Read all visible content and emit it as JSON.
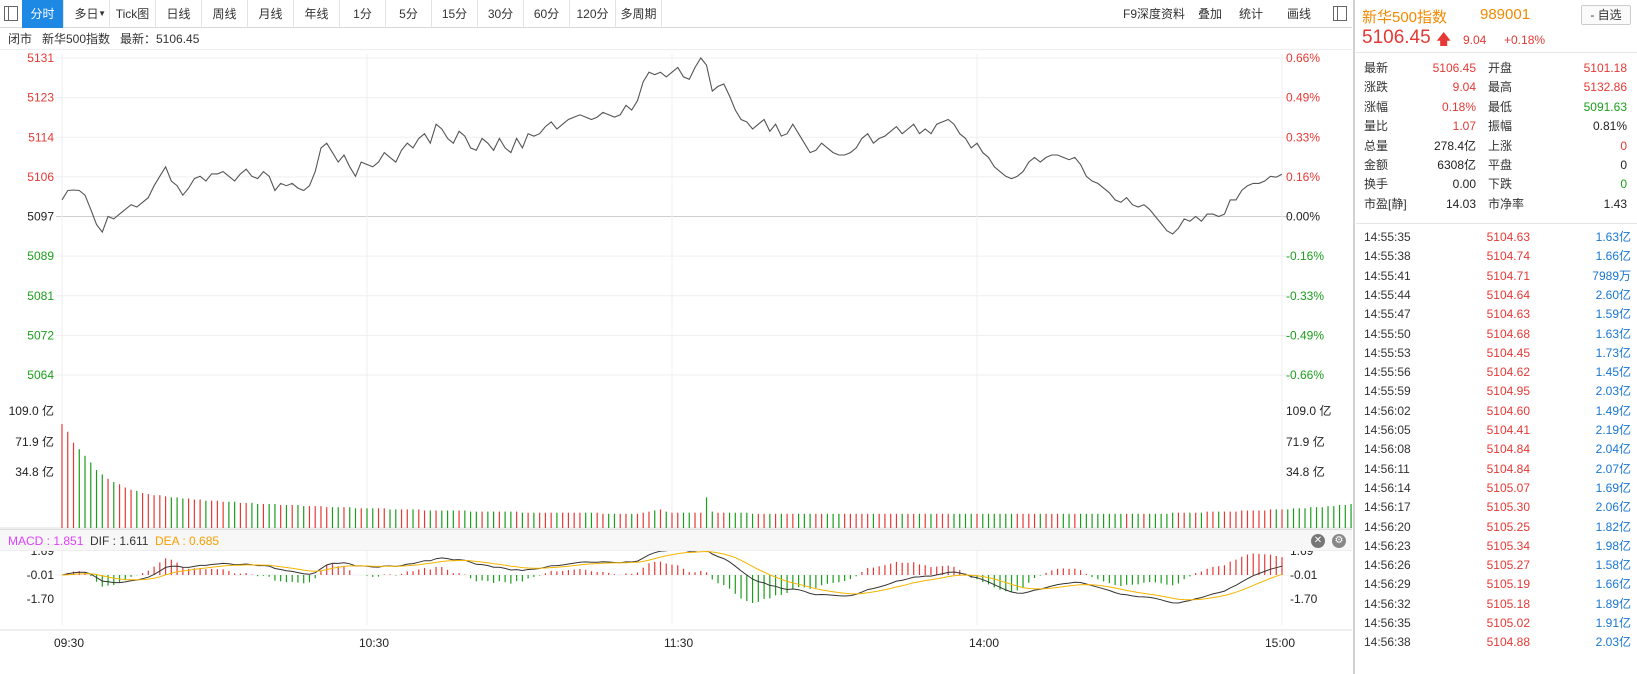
{
  "toolbar": {
    "tabs": [
      "分时",
      "多日",
      "Tick图",
      "日线",
      "周线",
      "月线",
      "年线",
      "1分",
      "5分",
      "15分",
      "30分",
      "60分",
      "120分",
      "多周期"
    ],
    "right_buttons": [
      "F9深度资料",
      "叠加",
      "统计",
      "画线"
    ]
  },
  "infobar": {
    "status": "闭市",
    "index_name": "新华500指数",
    "latest_label": "最新：5106.45"
  },
  "price_axis": {
    "left": [
      "5131",
      "5123",
      "5114",
      "5106",
      "5097",
      "5089",
      "5081",
      "5072",
      "5064"
    ],
    "right": [
      "0.66%",
      "0.49%",
      "0.33%",
      "0.16%",
      "0.00%",
      "-0.16%",
      "-0.33%",
      "-0.49%",
      "-0.66%"
    ]
  },
  "volume_axis": [
    "109.0 亿",
    "71.9 亿",
    "34.8 亿"
  ],
  "macd_header": {
    "macd": "MACD : 1.851",
    "dif": "DIF : 1.611",
    "dea": "DEA : 0.685"
  },
  "macd_axis": [
    "1.69",
    "-0.01",
    "-1.70"
  ],
  "time_axis": [
    "09:30",
    "10:30",
    "11:30",
    "14:00",
    "15:00"
  ],
  "chart_data": {
    "type": "line",
    "prev_close": 5097.41,
    "price_range": [
      5064,
      5131
    ],
    "price": [
      5101.0,
      5103.0,
      5103.1,
      5103.0,
      5102.0,
      5099.0,
      5095.8,
      5094.2,
      5097.5,
      5097.0,
      5098.0,
      5099.0,
      5100.0,
      5099.5,
      5100.5,
      5101.5,
      5104.0,
      5106.0,
      5108.0,
      5105.0,
      5104.0,
      5102.0,
      5103.5,
      5105.5,
      5106.0,
      5105.0,
      5106.5,
      5106.5,
      5107.0,
      5106.0,
      5105.0,
      5106.5,
      5107.5,
      5106.0,
      5105.5,
      5107.0,
      5106.0,
      5103.0,
      5104.5,
      5104.0,
      5104.5,
      5103.5,
      5103.0,
      5104.0,
      5107.0,
      5112.0,
      5113.0,
      5111.0,
      5109.0,
      5110.5,
      5108.0,
      5106.0,
      5109.0,
      5108.5,
      5108.0,
      5109.0,
      5111.0,
      5110.0,
      5109.0,
      5111.5,
      5113.0,
      5112.0,
      5114.0,
      5115.0,
      5113.0,
      5117.0,
      5116.0,
      5114.0,
      5113.0,
      5115.5,
      5114.5,
      5112.0,
      5111.5,
      5114.0,
      5113.0,
      5111.5,
      5114.0,
      5112.0,
      5111.0,
      5114.0,
      5112.0,
      5115.0,
      5114.5,
      5115.0,
      5116.5,
      5117.5,
      5116.0,
      5117.0,
      5118.0,
      5118.5,
      5119.0,
      5118.5,
      5118.0,
      5118.5,
      5119.5,
      5119.0,
      5118.5,
      5119.0,
      5121.0,
      5120.0,
      5122.0,
      5126.0,
      5128.0,
      5127.5,
      5128.0,
      5127.0,
      5128.0,
      5129.0,
      5127.0,
      5126.5,
      5129.0,
      5131.0,
      5129.5,
      5124.0,
      5125.0,
      5125.5,
      5123.0,
      5120.0,
      5118.0,
      5117.5,
      5116.0,
      5117.0,
      5118.0,
      5115.5,
      5117.0,
      5114.5,
      5115.0,
      5117.0,
      5115.0,
      5113.0,
      5111.0,
      5111.5,
      5113.0,
      5112.0,
      5111.0,
      5110.5,
      5110.5,
      5111.0,
      5112.0,
      5114.0,
      5115.0,
      5113.0,
      5114.0,
      5114.5,
      5115.5,
      5116.5,
      5115.0,
      5116.0,
      5117.0,
      5115.0,
      5116.0,
      5115.0,
      5117.0,
      5117.5,
      5118.0,
      5117.0,
      5115.0,
      5114.0,
      5112.0,
      5113.0,
      5111.0,
      5110.0,
      5108.0,
      5107.0,
      5106.0,
      5105.5,
      5106.0,
      5107.0,
      5109.0,
      5110.0,
      5109.0,
      5110.0,
      5110.5,
      5110.5,
      5110.0,
      5109.5,
      5110.0,
      5108.5,
      5106.0,
      5105.0,
      5104.5,
      5103.5,
      5102.5,
      5101.0,
      5100.5,
      5101.5,
      5100.0,
      5099.5,
      5100.0,
      5099.0,
      5097.5,
      5096.0,
      5094.5,
      5093.8,
      5095.0,
      5097.0,
      5096.5,
      5097.5,
      5096.5,
      5098.0,
      5098.0,
      5097.5,
      5098.0,
      5101.0,
      5101.0,
      5103.0,
      5104.0,
      5104.5,
      5104.5,
      5105.0,
      5106.0,
      5105.8,
      5106.45
    ],
    "volume_yi": [
      95,
      88,
      78,
      72,
      66,
      60,
      53,
      49,
      45,
      42,
      40,
      37,
      35,
      34,
      32,
      31,
      30,
      30,
      29,
      28,
      28,
      27,
      27,
      26,
      26,
      25,
      25,
      25,
      24,
      24,
      24,
      23,
      23,
      23,
      22,
      22,
      22,
      22,
      21,
      21,
      21,
      21,
      20,
      20,
      20,
      20,
      19,
      19,
      19,
      19,
      19,
      18,
      18,
      18,
      18,
      18,
      18,
      17,
      17,
      17,
      17,
      17,
      17,
      16,
      16,
      16,
      16,
      16,
      16,
      16,
      16,
      15,
      15,
      15,
      15,
      15,
      15,
      15,
      15,
      15,
      14,
      14,
      14,
      14,
      14,
      14,
      14,
      14,
      14,
      14,
      14,
      14,
      14,
      14,
      13,
      13,
      13,
      13,
      13,
      13,
      13,
      14,
      15,
      16,
      17,
      15,
      14,
      14,
      14,
      14,
      14,
      14,
      28,
      15,
      14,
      14,
      14,
      14,
      14,
      14,
      13,
      13,
      13,
      13,
      13,
      13,
      13,
      13,
      13,
      13,
      13,
      13,
      13,
      13,
      13,
      13,
      13,
      13,
      13,
      13,
      13,
      13,
      13,
      13,
      13,
      13,
      13,
      13,
      13,
      13,
      13,
      13,
      13,
      13,
      13,
      13,
      13,
      13,
      13,
      13,
      13,
      13,
      13,
      13,
      13,
      13,
      13,
      13,
      13,
      13,
      13,
      13,
      13,
      13,
      13,
      13,
      13,
      13,
      13,
      13,
      13,
      13,
      13,
      13,
      13,
      13,
      13,
      13,
      13,
      13,
      13,
      13,
      13,
      14,
      14,
      14,
      14,
      14,
      14,
      15,
      15,
      15,
      15,
      15,
      15,
      16,
      16,
      16,
      16,
      16,
      17,
      17,
      17,
      17,
      18,
      18,
      18,
      19,
      19,
      19,
      20,
      20,
      21,
      21,
      22,
      23,
      24,
      26,
      30,
      50
    ],
    "volume_range": [
      0,
      128
    ]
  },
  "panel": {
    "title": "新华500指数",
    "code": "989001",
    "watch_button": "- 自选",
    "price": "5106.45",
    "change": "9.04",
    "change_pct": "+0.18%",
    "quote_rows": [
      {
        "l1": "最新",
        "v1": "5106.45",
        "c1": "#e53935",
        "l2": "开盘",
        "v2": "5101.18",
        "c2": "#e53935"
      },
      {
        "l1": "涨跌",
        "v1": "9.04",
        "c1": "#e53935",
        "l2": "最高",
        "v2": "5132.86",
        "c2": "#e53935"
      },
      {
        "l1": "涨幅",
        "v1": "0.18%",
        "c1": "#e53935",
        "l2": "最低",
        "v2": "5091.63",
        "c2": "#1b9e1b"
      },
      {
        "l1": "量比",
        "v1": "1.07",
        "c1": "#e53935",
        "l2": "振幅",
        "v2": "0.81%",
        "c2": "#222222"
      },
      {
        "l1": "总量",
        "v1": "278.4亿",
        "c1": "#222222",
        "l2": "上涨",
        "v2": "0",
        "c2": "#e53935"
      },
      {
        "l1": "金额",
        "v1": "6308亿",
        "c1": "#222222",
        "l2": "平盘",
        "v2": "0",
        "c2": "#222222"
      },
      {
        "l1": "换手",
        "v1": "0.00",
        "c1": "#222222",
        "l2": "下跌",
        "v2": "0",
        "c2": "#1b9e1b"
      },
      {
        "l1": "市盈[静]",
        "v1": "14.03",
        "c1": "#222222",
        "l2": "市净率",
        "v2": "1.43",
        "c2": "#222222"
      }
    ],
    "ticks": [
      {
        "time": "14:55:35",
        "price": "5104.63",
        "amount": "1.63亿"
      },
      {
        "time": "14:55:38",
        "price": "5104.74",
        "amount": "1.66亿"
      },
      {
        "time": "14:55:41",
        "price": "5104.71",
        "amount": "7989万"
      },
      {
        "time": "14:55:44",
        "price": "5104.64",
        "amount": "2.60亿"
      },
      {
        "time": "14:55:47",
        "price": "5104.63",
        "amount": "1.59亿"
      },
      {
        "time": "14:55:50",
        "price": "5104.68",
        "amount": "1.63亿"
      },
      {
        "time": "14:55:53",
        "price": "5104.45",
        "amount": "1.73亿"
      },
      {
        "time": "14:55:56",
        "price": "5104.62",
        "amount": "1.45亿"
      },
      {
        "time": "14:55:59",
        "price": "5104.95",
        "amount": "2.03亿"
      },
      {
        "time": "14:56:02",
        "price": "5104.60",
        "amount": "1.49亿"
      },
      {
        "time": "14:56:05",
        "price": "5104.41",
        "amount": "2.19亿"
      },
      {
        "time": "14:56:08",
        "price": "5104.84",
        "amount": "2.04亿"
      },
      {
        "time": "14:56:11",
        "price": "5104.84",
        "amount": "2.07亿"
      },
      {
        "time": "14:56:14",
        "price": "5105.07",
        "amount": "1.69亿"
      },
      {
        "time": "14:56:17",
        "price": "5105.30",
        "amount": "2.06亿"
      },
      {
        "time": "14:56:20",
        "price": "5105.25",
        "amount": "1.82亿"
      },
      {
        "time": "14:56:23",
        "price": "5105.34",
        "amount": "1.98亿"
      },
      {
        "time": "14:56:26",
        "price": "5105.27",
        "amount": "1.58亿"
      },
      {
        "time": "14:56:29",
        "price": "5105.19",
        "amount": "1.66亿"
      },
      {
        "time": "14:56:32",
        "price": "5105.18",
        "amount": "1.89亿"
      },
      {
        "time": "14:56:35",
        "price": "5105.02",
        "amount": "1.91亿"
      },
      {
        "time": "14:56:38",
        "price": "5104.88",
        "amount": "2.03亿"
      }
    ]
  },
  "colors": {
    "up": "#e53935",
    "down": "#1b9e1b",
    "accent": "#1e88e5",
    "brand": "#f08a00",
    "amount": "#1976d2",
    "dea": "#f5b400",
    "dif": "#333333",
    "macd": "#e040fb"
  }
}
